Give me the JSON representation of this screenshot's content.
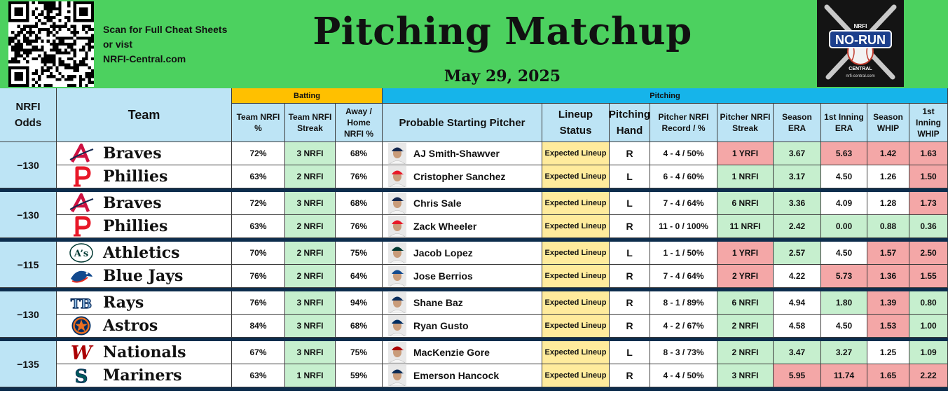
{
  "header": {
    "scan_line1": "Scan for Full Cheat Sheets",
    "scan_line2": "or vist",
    "scan_line3": "NRFI-Central.com",
    "title": "Pitching Matchup",
    "date": "May 29, 2025",
    "logo_text_top": "NO-RUN",
    "logo_text_bottom": "CENTRAL",
    "logo_small": "NRFI",
    "logo_url": "nrfi-central.com"
  },
  "groups": {
    "batting": "Batting",
    "pitching": "Pitching"
  },
  "columns": {
    "odds": "NRFI Odds",
    "team": "Team",
    "team_nrfi_pct": "Team NRFI %",
    "team_nrfi_streak": "Team NRFI Streak",
    "away_home_nrfi_pct": "Away / Home NRFI %",
    "pitcher": "Probable Starting Pitcher",
    "lineup_status": "Lineup Status",
    "pitching_hand": "Pitching Hand",
    "pitcher_record": "Pitcher NRFI Record /  %",
    "pitcher_streak": "Pitcher NRFI Streak",
    "season_era": "Season ERA",
    "first_inning_era": "1st Inning ERA",
    "season_whip": "Season WHIP",
    "first_inning_whip": "1st Inning WHIP"
  },
  "games": [
    {
      "odds": "−130",
      "rows": [
        {
          "team": "Braves",
          "logo": "braves-logo",
          "nrfi_pct": "72%",
          "streak": "3 NRFI",
          "away_home": "68%",
          "pitcher": "AJ Smith-Shawver",
          "lineup": "Expected Lineup",
          "hand": "R",
          "record": "4 - 4 / 50%",
          "p_streak": "1 YRFI",
          "p_streak_c": "red",
          "era": "3.67",
          "era_c": "green",
          "era1": "5.63",
          "era1_c": "red",
          "whip": "1.42",
          "whip_c": "red",
          "whip1": "1.63",
          "whip1_c": "red"
        },
        {
          "team": "Phillies",
          "logo": "phillies-logo",
          "nrfi_pct": "63%",
          "streak": "2 NRFI",
          "away_home": "76%",
          "pitcher": "Cristopher Sanchez",
          "lineup": "Expected Lineup",
          "hand": "L",
          "record": "6 - 4 / 60%",
          "p_streak": "1 NRFI",
          "p_streak_c": "green",
          "era": "3.17",
          "era_c": "green",
          "era1": "4.50",
          "era1_c": "white",
          "whip": "1.26",
          "whip_c": "white",
          "whip1": "1.50",
          "whip1_c": "red"
        }
      ]
    },
    {
      "odds": "−130",
      "rows": [
        {
          "team": "Braves",
          "logo": "braves-logo",
          "nrfi_pct": "72%",
          "streak": "3 NRFI",
          "away_home": "68%",
          "pitcher": "Chris Sale",
          "lineup": "Expected Lineup",
          "hand": "L",
          "record": "7 - 4 / 64%",
          "p_streak": "6 NRFI",
          "p_streak_c": "green",
          "era": "3.36",
          "era_c": "green",
          "era1": "4.09",
          "era1_c": "white",
          "whip": "1.28",
          "whip_c": "white",
          "whip1": "1.73",
          "whip1_c": "red"
        },
        {
          "team": "Phillies",
          "logo": "phillies-logo",
          "nrfi_pct": "63%",
          "streak": "2 NRFI",
          "away_home": "76%",
          "pitcher": "Zack Wheeler",
          "lineup": "Expected Lineup",
          "hand": "R",
          "record": "11 - 0 / 100%",
          "p_streak": "11 NRFI",
          "p_streak_c": "green",
          "era": "2.42",
          "era_c": "green",
          "era1": "0.00",
          "era1_c": "green",
          "whip": "0.88",
          "whip_c": "green",
          "whip1": "0.36",
          "whip1_c": "green"
        }
      ]
    },
    {
      "odds": "−115",
      "rows": [
        {
          "team": "Athletics",
          "logo": "athletics-logo",
          "nrfi_pct": "70%",
          "streak": "2 NRFI",
          "away_home": "75%",
          "pitcher": "Jacob Lopez",
          "lineup": "Expected Lineup",
          "hand": "L",
          "record": "1 - 1 / 50%",
          "p_streak": "1 YRFI",
          "p_streak_c": "red",
          "era": "2.57",
          "era_c": "green",
          "era1": "4.50",
          "era1_c": "white",
          "whip": "1.57",
          "whip_c": "red",
          "whip1": "2.50",
          "whip1_c": "red"
        },
        {
          "team": "Blue Jays",
          "logo": "blue-jays-logo",
          "nrfi_pct": "76%",
          "streak": "2 NRFI",
          "away_home": "64%",
          "pitcher": "Jose Berrios",
          "lineup": "Expected Lineup",
          "hand": "R",
          "record": "7 - 4 / 64%",
          "p_streak": "2 YRFI",
          "p_streak_c": "red",
          "era": "4.22",
          "era_c": "white",
          "era1": "5.73",
          "era1_c": "red",
          "whip": "1.36",
          "whip_c": "red",
          "whip1": "1.55",
          "whip1_c": "red"
        }
      ]
    },
    {
      "odds": "−130",
      "rows": [
        {
          "team": "Rays",
          "logo": "rays-logo",
          "nrfi_pct": "76%",
          "streak": "3 NRFI",
          "away_home": "94%",
          "pitcher": "Shane Baz",
          "lineup": "Expected Lineup",
          "hand": "R",
          "record": "8 - 1 / 89%",
          "p_streak": "6 NRFI",
          "p_streak_c": "green",
          "era": "4.94",
          "era_c": "white",
          "era1": "1.80",
          "era1_c": "green",
          "whip": "1.39",
          "whip_c": "red",
          "whip1": "0.80",
          "whip1_c": "green"
        },
        {
          "team": "Astros",
          "logo": "astros-logo",
          "nrfi_pct": "84%",
          "streak": "3 NRFI",
          "away_home": "68%",
          "pitcher": "Ryan Gusto",
          "lineup": "Expected Lineup",
          "hand": "R",
          "record": "4 - 2 / 67%",
          "p_streak": "2 NRFI",
          "p_streak_c": "green",
          "era": "4.58",
          "era_c": "white",
          "era1": "4.50",
          "era1_c": "white",
          "whip": "1.53",
          "whip_c": "red",
          "whip1": "1.00",
          "whip1_c": "green"
        }
      ]
    },
    {
      "odds": "−135",
      "rows": [
        {
          "team": "Nationals",
          "logo": "nationals-logo",
          "nrfi_pct": "67%",
          "streak": "3 NRFI",
          "away_home": "75%",
          "pitcher": "MacKenzie Gore",
          "lineup": "Expected Lineup",
          "hand": "L",
          "record": "8 - 3 / 73%",
          "p_streak": "2 NRFI",
          "p_streak_c": "green",
          "era": "3.47",
          "era_c": "green",
          "era1": "3.27",
          "era1_c": "green",
          "whip": "1.25",
          "whip_c": "white",
          "whip1": "1.09",
          "whip1_c": "green"
        },
        {
          "team": "Mariners",
          "logo": "mariners-logo",
          "nrfi_pct": "63%",
          "streak": "1 NRFI",
          "away_home": "59%",
          "pitcher": "Emerson Hancock",
          "lineup": "Expected Lineup",
          "hand": "R",
          "record": "4 - 4 / 50%",
          "p_streak": "3 NRFI",
          "p_streak_c": "green",
          "era": "5.95",
          "era_c": "red",
          "era1": "11.74",
          "era1_c": "red",
          "whip": "1.65",
          "whip_c": "red",
          "whip1": "2.22",
          "whip1_c": "red"
        }
      ]
    }
  ]
}
